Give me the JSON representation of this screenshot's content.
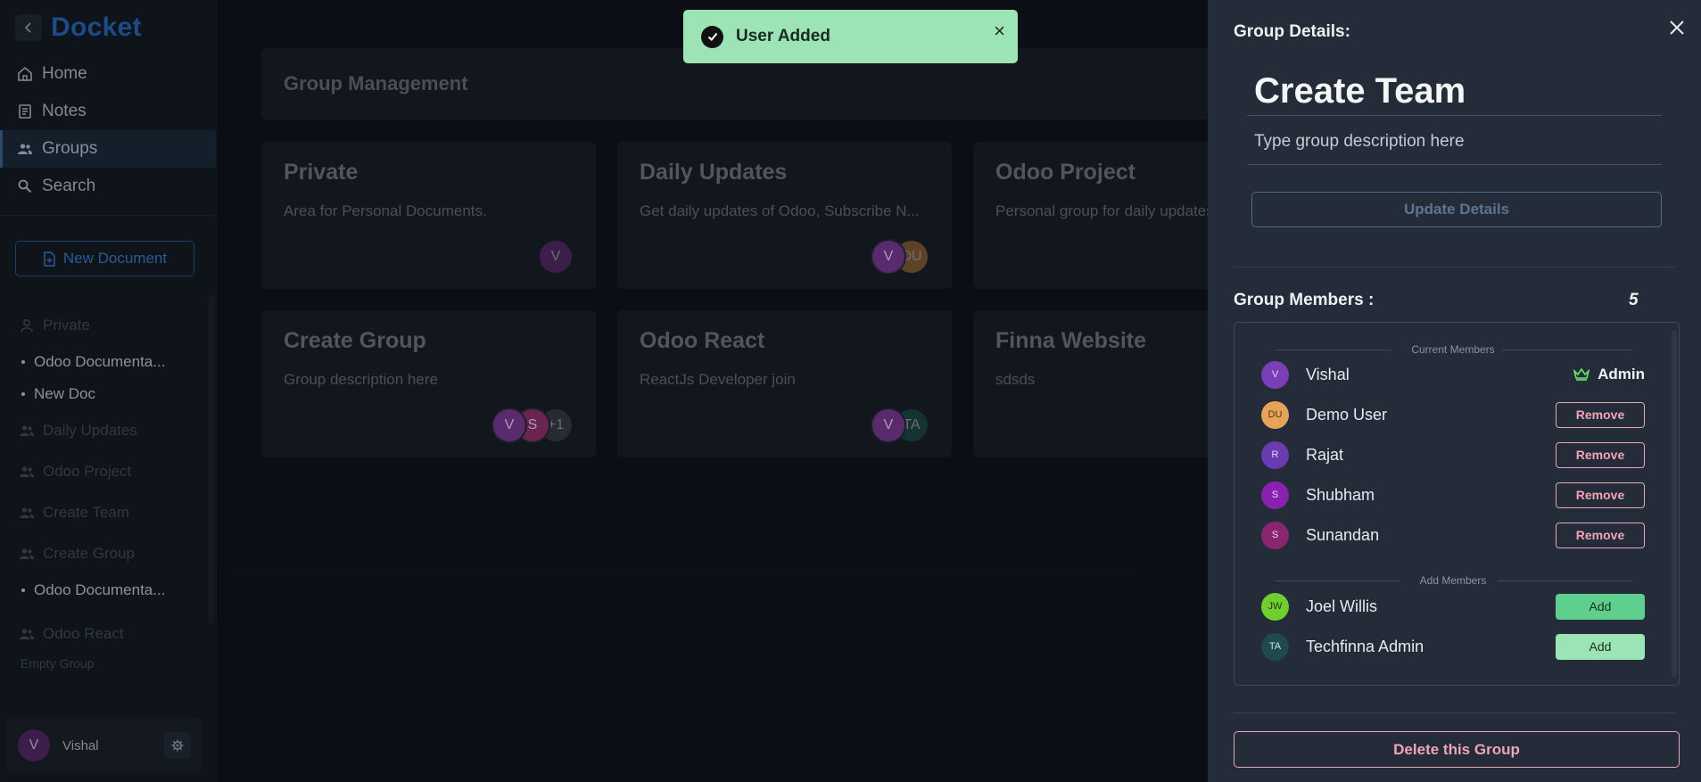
{
  "app": {
    "name": "Docket"
  },
  "nav": [
    {
      "label": "Home",
      "icon": "home-icon"
    },
    {
      "label": "Notes",
      "icon": "notes-icon"
    },
    {
      "label": "Groups",
      "icon": "groups-icon",
      "active": true
    },
    {
      "label": "Search",
      "icon": "search-icon"
    }
  ],
  "new_document_label": "New Document",
  "tree": {
    "private": "Private",
    "private_docs": [
      "Odoo Documenta...",
      "New Doc"
    ],
    "daily_updates": "Daily Updates",
    "odoo_project": "Odoo Project",
    "create_team": "Create Team",
    "create_group": "Create Group",
    "create_group_docs": [
      "Odoo Documenta..."
    ],
    "odoo_react": "Odoo React",
    "odoo_react_empty": "Empty Group"
  },
  "user": {
    "name": "Vishal",
    "initial": "V"
  },
  "main": {
    "title": "Group Management",
    "cards": [
      {
        "title": "Private",
        "desc": "Area for Personal Documents.",
        "avatars": [
          {
            "t": "V",
            "c": "#5a2a6e"
          }
        ]
      },
      {
        "title": "Daily Updates",
        "desc": "Get daily updates of Odoo, Subscribe N...",
        "avatars": [
          {
            "t": "V",
            "c": "#5a2a6e"
          },
          {
            "t": "DU",
            "c": "#8c6235"
          }
        ]
      },
      {
        "title": "Odoo Project",
        "desc": "Personal group for daily updates",
        "avatars": []
      },
      {
        "title": "Create Group",
        "desc": "Group description here",
        "avatars": [
          {
            "t": "V",
            "c": "#5a2a6e"
          },
          {
            "t": "S",
            "c": "#6b2350"
          },
          {
            "t": "+1",
            "c": "#3a3f48"
          }
        ]
      },
      {
        "title": "Odoo React",
        "desc": "ReactJs Developer join",
        "avatars": [
          {
            "t": "V",
            "c": "#5a2a6e"
          },
          {
            "t": "TA",
            "c": "#1e4a48"
          }
        ]
      },
      {
        "title": "Finna Website",
        "desc": "sdsds",
        "avatars": []
      }
    ]
  },
  "toast": {
    "message": "User Added",
    "close": "×"
  },
  "panel": {
    "label": "Group Details:",
    "title_value": "Create Team",
    "desc_placeholder": "Type group description here",
    "update_label": "Update Details",
    "members_label": "Group Members :",
    "members_count": "5",
    "current_members_label": "Current Members",
    "add_members_label": "Add Members",
    "current_members": [
      {
        "name": "Vishal",
        "initials": "V",
        "color": "#7a3fb6",
        "role": "Admin"
      },
      {
        "name": "Demo User",
        "initials": "DU",
        "color": "#e6a35a",
        "action": "Remove"
      },
      {
        "name": "Rajat",
        "initials": "R",
        "color": "#6a3ab0",
        "action": "Remove"
      },
      {
        "name": "Shubham",
        "initials": "S",
        "color": "#8a22b0",
        "action": "Remove"
      },
      {
        "name": "Sunandan",
        "initials": "S",
        "color": "#8a2670",
        "action": "Remove"
      }
    ],
    "add_members": [
      {
        "name": "Joel Willis",
        "initials": "JW",
        "color": "#6ecf2e",
        "action": "Add"
      },
      {
        "name": "Techfinna Admin",
        "initials": "TA",
        "color": "#1f4a4c",
        "action": "Add"
      }
    ],
    "delete_label": "Delete this Group"
  }
}
